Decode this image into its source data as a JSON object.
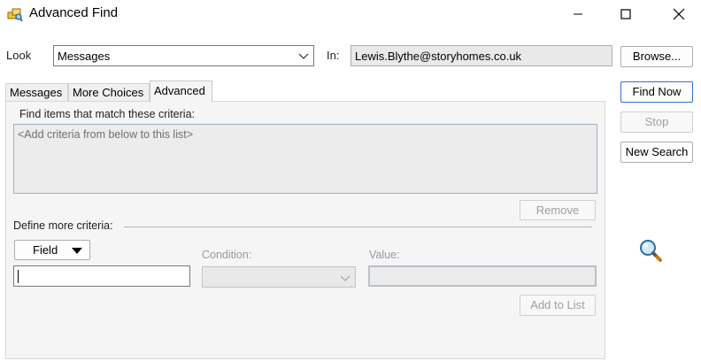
{
  "window": {
    "title": "Advanced Find",
    "minimize_glyph": "—",
    "maximize_glyph": "☐",
    "close_glyph": "✕"
  },
  "look": {
    "label": "Look",
    "selected": "Messages"
  },
  "in": {
    "label": "In:",
    "value": "Lewis.Blythe@storyhomes.co.uk"
  },
  "buttons": {
    "browse": "Browse...",
    "find_now": "Find Now",
    "stop": "Stop",
    "new_search": "New Search",
    "remove": "Remove",
    "field": "Field",
    "add_to_list": "Add to List"
  },
  "tabs": [
    {
      "label": "Messages"
    },
    {
      "label": "More Choices"
    },
    {
      "label": "Advanced",
      "active": true
    }
  ],
  "criteria": {
    "heading": "Find items that match these criteria:",
    "placeholder": "<Add criteria from below to this list>"
  },
  "define": {
    "heading": "Define more criteria:",
    "condition_label": "Condition:",
    "value_label": "Value:",
    "field_value": "",
    "condition_value": "",
    "value_value": ""
  },
  "icons": {
    "app": "advanced-find-app-icon",
    "search": "magnifier-icon"
  },
  "colors": {
    "default_button_border": "#2b73c8",
    "panel_bg": "#f5f5f5",
    "disabled_text": "#a0a0a0"
  }
}
